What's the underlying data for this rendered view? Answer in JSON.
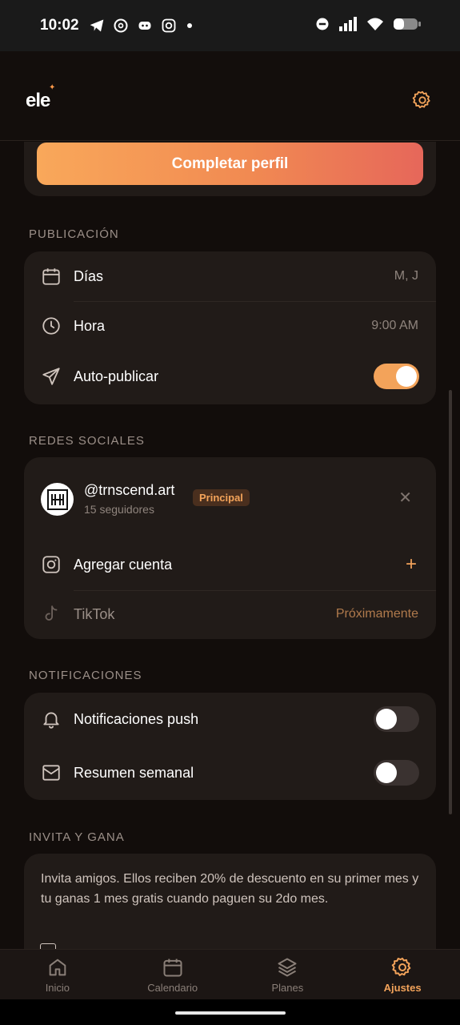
{
  "status_bar": {
    "time": "10:02"
  },
  "app": {
    "logo": "ele"
  },
  "profile": {
    "cta_label": "Completar perfil"
  },
  "publicacion": {
    "title": "PUBLICACIÓN",
    "dias_label": "Días",
    "dias_value": "M, J",
    "hora_label": "Hora",
    "hora_value": "9:00 AM",
    "auto_label": "Auto-publicar",
    "auto_on": true
  },
  "redes": {
    "title": "REDES SOCIALES",
    "account_handle": "@trnscend.art",
    "account_followers": "15 seguidores",
    "account_badge": "Principal",
    "add_label": "Agregar cuenta",
    "tiktok_label": "TikTok",
    "tiktok_status": "Próximamente"
  },
  "notificaciones": {
    "title": "NOTIFICACIONES",
    "push_label": "Notificaciones push",
    "push_on": false,
    "weekly_label": "Resumen semanal",
    "weekly_on": false
  },
  "invita": {
    "title": "INVITA Y GANA",
    "text": "Invita amigos. Ellos reciben 20% de descuento en su primer mes y tu ganas 1 mes gratis cuando paguen su 2do mes."
  },
  "tabs": [
    {
      "label": "Inicio",
      "icon": "home-icon"
    },
    {
      "label": "Calendario",
      "icon": "calendar-icon"
    },
    {
      "label": "Planes",
      "icon": "layers-icon"
    },
    {
      "label": "Ajustes",
      "icon": "gear-icon"
    }
  ],
  "colors": {
    "accent": "#f3a35a",
    "background": "#120d0b",
    "card": "#211b18"
  }
}
